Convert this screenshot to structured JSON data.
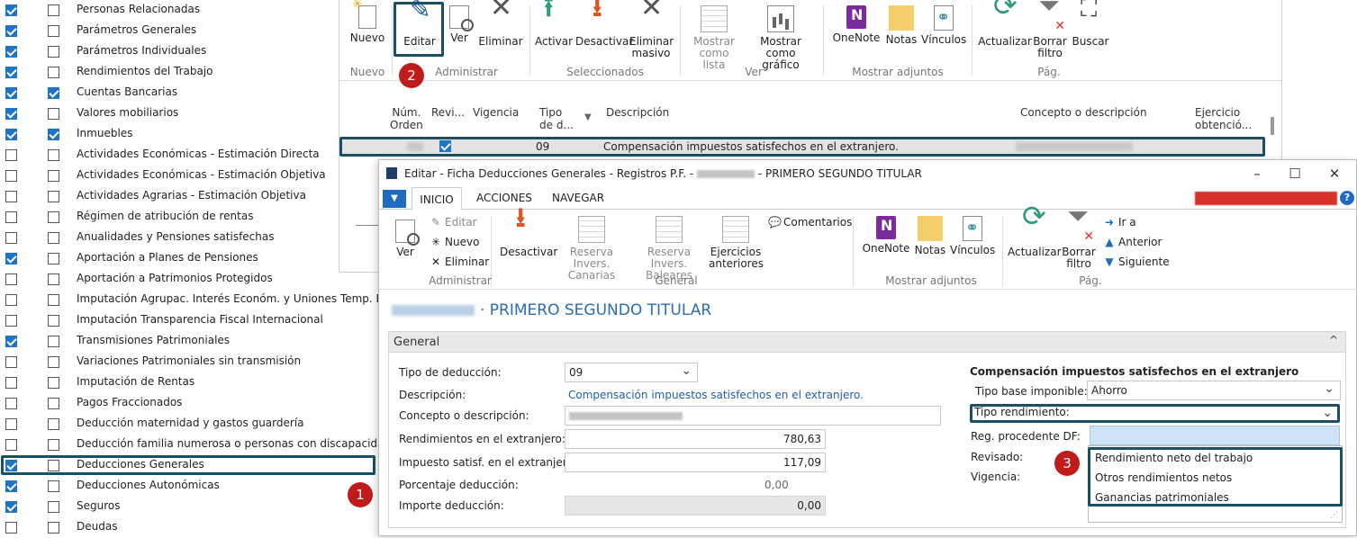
{
  "left_list": [
    {
      "label": "Personas Relacionadas",
      "c1": true,
      "c2": false
    },
    {
      "label": "Parámetros Generales",
      "c1": true,
      "c2": false
    },
    {
      "label": "Parámetros Individuales",
      "c1": true,
      "c2": false
    },
    {
      "label": "Rendimientos del Trabajo",
      "c1": true,
      "c2": false
    },
    {
      "label": "Cuentas Bancarias",
      "c1": true,
      "c2": true
    },
    {
      "label": "Valores mobiliarios",
      "c1": true,
      "c2": false
    },
    {
      "label": "Inmuebles",
      "c1": true,
      "c2": true
    },
    {
      "label": "Actividades Económicas - Estimación Directa",
      "c1": false,
      "c2": false
    },
    {
      "label": "Actividades Económicas - Estimación Objetiva",
      "c1": false,
      "c2": false
    },
    {
      "label": "Actividades Agrarias - Estimación Objetiva",
      "c1": false,
      "c2": false
    },
    {
      "label": "Régimen de atribución de rentas",
      "c1": false,
      "c2": false
    },
    {
      "label": "Anualidades y Pensiones satisfechas",
      "c1": false,
      "c2": false
    },
    {
      "label": "Aportación a Planes de Pensiones",
      "c1": true,
      "c2": false
    },
    {
      "label": "Aportación a Patrimonios Protegidos",
      "c1": false,
      "c2": false
    },
    {
      "label": "Imputación Agrupac. Interés Económ. y Uniones Temp. Empresas",
      "c1": false,
      "c2": false
    },
    {
      "label": "Imputación Transparencia Fiscal Internacional",
      "c1": false,
      "c2": false
    },
    {
      "label": "Transmisiones Patrimoniales",
      "c1": true,
      "c2": false
    },
    {
      "label": "Variaciones Patrimoniales sin transmisión",
      "c1": false,
      "c2": false
    },
    {
      "label": "Imputación de Rentas",
      "c1": false,
      "c2": false
    },
    {
      "label": "Pagos Fraccionados",
      "c1": false,
      "c2": false
    },
    {
      "label": "Deducción maternidad y gastos guardería",
      "c1": false,
      "c2": false
    },
    {
      "label": "Deducción familia numerosa o personas con discapacidad",
      "c1": false,
      "c2": false
    },
    {
      "label": "Deducciones Generales",
      "c1": true,
      "c2": false
    },
    {
      "label": "Deducciones Autonómicas",
      "c1": true,
      "c2": false
    },
    {
      "label": "Seguros",
      "c1": true,
      "c2": false
    },
    {
      "label": "Deudas",
      "c1": false,
      "c2": false
    }
  ],
  "badges": {
    "b1": "1",
    "b2": "2",
    "b3": "3"
  },
  "main_ribbon": {
    "nuevo": "Nuevo",
    "editar": "Editar",
    "ver": "Ver",
    "eliminar": "Eliminar",
    "activar": "Activar",
    "desactivar": "Desactivar",
    "eliminar_masivo_1": "Eliminar",
    "eliminar_masivo_2": "masivo",
    "mostrar_lista_1": "Mostrar",
    "mostrar_lista_2": "como lista",
    "mostrar_grafico_1": "Mostrar como",
    "mostrar_grafico_2": "gráfico",
    "onenote": "OneNote",
    "notas": "Notas",
    "vinculos": "Vínculos",
    "actualizar": "Actualizar",
    "borrar_filtro_1": "Borrar",
    "borrar_filtro_2": "filtro",
    "buscar": "Buscar",
    "groups": {
      "nuevo": "Nuevo",
      "administrar": "Administrar",
      "seleccionados": "Seleccionados",
      "ver": "Ver",
      "adjuntos": "Mostrar adjuntos",
      "pag": "Pág."
    }
  },
  "main_grid": {
    "headers": {
      "num_1": "Núm.",
      "num_2": "Orden",
      "revi": "Revi...",
      "vigencia": "Vigencia",
      "tipo_1": "Tipo",
      "tipo_2": "de d...",
      "descripcion": "Descripción",
      "concepto": "Concepto o descripción",
      "ejercicio_1": "Ejercicio",
      "ejercicio_2": "obtenció..."
    },
    "row": {
      "tipo": "09",
      "descripcion": "Compensación impuestos satisfechos en el extranjero."
    }
  },
  "edit_window": {
    "title_prefix": "Editar - Ficha Deducciones Generales - Registros P.F. -",
    "title_suffix": "- PRIMERO SEGUNDO TITULAR",
    "tabs": {
      "inicio": "INICIO",
      "acciones": "ACCIONES",
      "navegar": "NAVEGAR"
    },
    "ribbon": {
      "ver": "Ver",
      "editar": "Editar",
      "nuevo": "Nuevo",
      "eliminar": "Eliminar",
      "desactivar": "Desactivar",
      "reserva_canarias_1": "Reserva Invers.",
      "reserva_canarias_2": "Canarias",
      "reserva_baleares_1": "Reserva Invers.",
      "reserva_baleares_2": "Baleares",
      "ejercicios_1": "Ejercicios",
      "ejercicios_2": "anteriores",
      "comentarios": "Comentarios",
      "onenote": "OneNote",
      "notas": "Notas",
      "vinculos": "Vínculos",
      "actualizar": "Actualizar",
      "borrar_1": "Borrar",
      "borrar_2": "filtro",
      "ir_a": "Ir a",
      "anterior": "Anterior",
      "siguiente": "Siguiente",
      "groups": {
        "administrar": "Administrar",
        "general": "General",
        "adjuntos": "Mostrar adjuntos",
        "pag": "Pág."
      }
    },
    "record_title": "· PRIMERO SEGUNDO TITULAR",
    "section_title": "General",
    "fields": {
      "tipo_deduccion_label": "Tipo de deducción:",
      "tipo_deduccion_value": "09",
      "descripcion_label": "Descripción:",
      "descripcion_value": "Compensación impuestos satisfechos en el extranjero.",
      "concepto_label": "Concepto o descripción:",
      "rend_extranjero_label": "Rendimientos en el extranjero:",
      "rend_extranjero_value": "780,63",
      "impuesto_label": "Impuesto satisf. en el extranjero:",
      "impuesto_value": "117,09",
      "porcentaje_label": "Porcentaje deducción:",
      "porcentaje_value": "0,00",
      "importe_label": "Importe deducción:",
      "importe_value": "0,00"
    },
    "right_section": {
      "heading": "Compensación impuestos satisfechos en el extranjero",
      "tipo_base_label": "Tipo base imponible:",
      "tipo_base_value": "Ahorro",
      "tipo_rend_label": "Tipo rendimiento:",
      "reg_label": "Reg. procedente DF:",
      "revisado_label": "Revisado:",
      "vigencia_label": "Vigencia:",
      "options": [
        "Rendimiento neto del trabajo",
        "Otros rendimientos netos",
        "Ganancias patrimoniales"
      ]
    }
  },
  "colors": {
    "accent": "#1e6bc0",
    "highlight": "#1b4f63",
    "badge": "#c01b1b",
    "link": "#1e5fa8"
  }
}
